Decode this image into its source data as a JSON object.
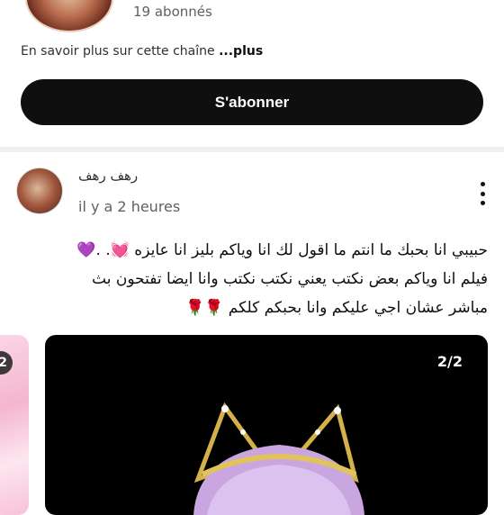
{
  "channel": {
    "subscribers": "19 abonnés",
    "about_text": "En savoir plus sur cette chaîne ",
    "about_more": "...plus",
    "subscribe_label": "S'abonner"
  },
  "post": {
    "author": "رهف رهف",
    "time": "il y a 2 heures",
    "lines": [
      "حبيبي انا بحبك ما انتم ما اقول لك انا وياكم بليز انا عايزه 💓. .💜",
      "فيلم انا وياكم بعض نكتب يعني نكتب نكتب وانا ايضا تفتحون بث",
      "مباشر عشان اجي عليكم وانا بحبكم كلكم 🌹🌹"
    ],
    "images": {
      "previous_counter": "2",
      "current_counter": "2/2"
    }
  },
  "colors": {
    "subscribe_bg": "#0f0f0f",
    "image_bg": "#000000"
  }
}
